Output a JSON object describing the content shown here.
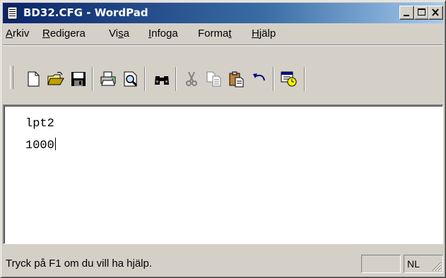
{
  "window": {
    "title": "BD32.CFG - WordPad",
    "icon": "wordpad-document-icon",
    "controls": [
      "minimize-icon",
      "maximize-icon",
      "close-icon"
    ]
  },
  "menubar": {
    "items": [
      {
        "label": "Arkiv",
        "accel_index": 0
      },
      {
        "label": "Redigera",
        "accel_index": 0
      },
      {
        "label": "Visa",
        "accel_index": 2
      },
      {
        "label": "Infoga",
        "accel_index": 0
      },
      {
        "label": "Format",
        "accel_index": 5
      },
      {
        "label": "Hjälp",
        "accel_index": 0
      }
    ]
  },
  "toolbar": {
    "buttons": [
      {
        "icon": "new-document-icon",
        "enabled": true
      },
      {
        "icon": "open-folder-icon",
        "enabled": true
      },
      {
        "icon": "save-disk-icon",
        "enabled": true
      },
      {
        "icon": "print-icon",
        "enabled": true
      },
      {
        "icon": "print-preview-icon",
        "enabled": true
      },
      {
        "icon": "find-binoculars-icon",
        "enabled": true
      },
      {
        "icon": "cut-scissors-icon",
        "enabled": false
      },
      {
        "icon": "copy-icon",
        "enabled": false
      },
      {
        "icon": "paste-icon",
        "enabled": true
      },
      {
        "icon": "undo-icon",
        "enabled": true
      },
      {
        "icon": "date-time-icon",
        "enabled": true
      }
    ]
  },
  "document": {
    "lines": [
      "lpt2",
      "1000"
    ]
  },
  "statusbar": {
    "help_text": "Tryck på F1 om du vill ha hjälp.",
    "num_lock": "NL"
  },
  "colors": {
    "face": "#d4d0c8",
    "title_start": "#0a246a",
    "title_end": "#a6caf0"
  }
}
